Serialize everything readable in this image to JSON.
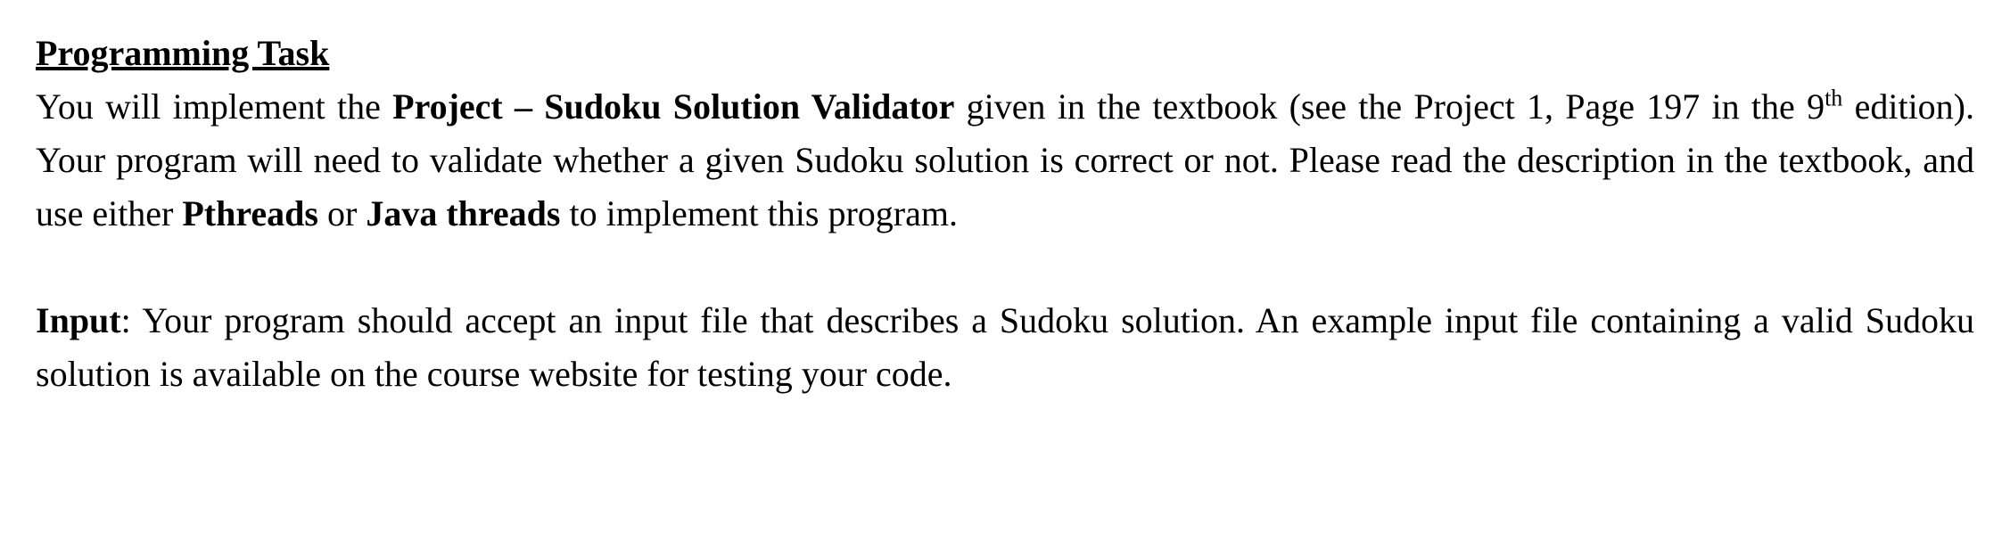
{
  "heading": "Programming Task",
  "para1": {
    "t1": "You will implement the ",
    "bold1": "Project – Sudoku Solution Validator",
    "t2": " given in the textbook (see the Project 1, Page 197 in the 9",
    "sup": "th",
    "t3": " edition).  Your program will need to validate whether a given Sudoku solution is correct or not.  Please read the description in the textbook, and use either ",
    "bold2": "Pthreads",
    "t4": " or ",
    "bold3": "Java threads",
    "t5": " to implement this program."
  },
  "para2": {
    "boldLabel": "Input",
    "t1": ": Your program should accept an input file that describes a Sudoku solution. An example input file containing a valid Sudoku solution is available on the course website for testing your code."
  }
}
